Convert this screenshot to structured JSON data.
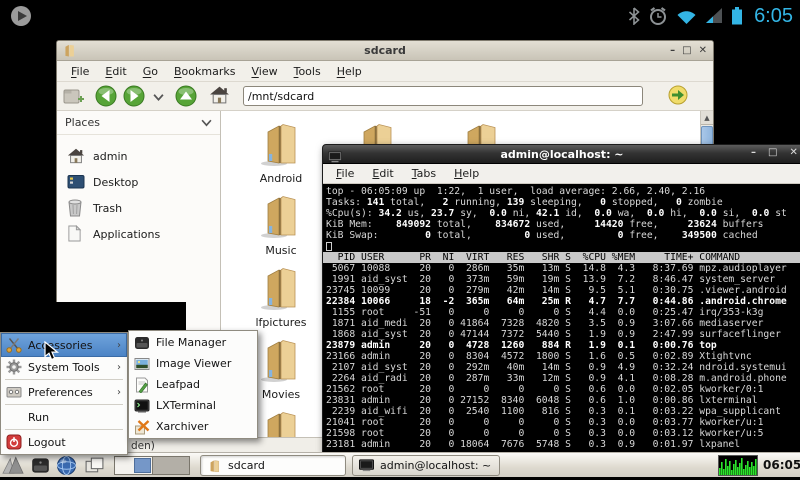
{
  "status_bar": {
    "time": "6:05",
    "accent_color": "#33b5e5",
    "icons": [
      "play-notification-icon",
      "bluetooth-icon",
      "alarm-icon",
      "wifi-icon",
      "signal-icon",
      "battery-icon"
    ]
  },
  "file_manager": {
    "title": "sdcard",
    "menu": [
      "File",
      "Edit",
      "Go",
      "Bookmarks",
      "View",
      "Tools",
      "Help"
    ],
    "toolbar": {
      "path_value": "/mnt/sdcard"
    },
    "sidebar": {
      "header": "Places",
      "items": [
        {
          "label": "admin",
          "icon": "home-icon"
        },
        {
          "label": "Desktop",
          "icon": "desktop-icon"
        },
        {
          "label": "Trash",
          "icon": "trash-icon"
        },
        {
          "label": "Applications",
          "icon": "applications-icon"
        }
      ]
    },
    "folders": [
      "Android",
      "Music",
      "lfpictures",
      "Movies"
    ],
    "status_text": "den)"
  },
  "terminal": {
    "title": "admin@localhost: ~",
    "menu": [
      "File",
      "Edit",
      "Tabs",
      "Help"
    ],
    "summary_lines": [
      [
        [
          "top - 06:05:09 up  1:22,  1 user,  load average: 2.66, 2.40, 2.16",
          0
        ]
      ],
      [
        [
          "Tasks: ",
          0
        ],
        [
          "141",
          1
        ],
        [
          " total,   ",
          0
        ],
        [
          "2",
          1
        ],
        [
          " running, ",
          0
        ],
        [
          "139",
          1
        ],
        [
          " sleeping,   ",
          0
        ],
        [
          "0",
          1
        ],
        [
          " stopped,   ",
          0
        ],
        [
          "0",
          1
        ],
        [
          " zombie",
          0
        ]
      ],
      [
        [
          "%Cpu(s): ",
          0
        ],
        [
          "34.2",
          1
        ],
        [
          " us, ",
          0
        ],
        [
          "23.7",
          1
        ],
        [
          " sy,  ",
          0
        ],
        [
          "0.0",
          1
        ],
        [
          " ni, ",
          0
        ],
        [
          "42.1",
          1
        ],
        [
          " id,  ",
          0
        ],
        [
          "0.0",
          1
        ],
        [
          " wa,  ",
          0
        ],
        [
          "0.0",
          1
        ],
        [
          " hi,  ",
          0
        ],
        [
          "0.0",
          1
        ],
        [
          " si,  ",
          0
        ],
        [
          "0.0",
          1
        ],
        [
          " st",
          0
        ]
      ],
      [
        [
          "KiB Mem:    ",
          0
        ],
        [
          "849092",
          1
        ],
        [
          " total,    ",
          0
        ],
        [
          "834672",
          1
        ],
        [
          " used,     ",
          0
        ],
        [
          "14420",
          1
        ],
        [
          " free,     ",
          0
        ],
        [
          "23624",
          1
        ],
        [
          " buffers",
          0
        ]
      ],
      [
        [
          "KiB Swap:        ",
          0
        ],
        [
          "0",
          1
        ],
        [
          " total,         ",
          0
        ],
        [
          "0",
          1
        ],
        [
          " used,         ",
          0
        ],
        [
          "0",
          1
        ],
        [
          " free,    ",
          0
        ],
        [
          "349500",
          1
        ],
        [
          " cached",
          0
        ]
      ]
    ],
    "table_header": "  PID USER      PR  NI  VIRT   RES   SHR S  %CPU %MEM     TIME+ COMMAND",
    "rows": [
      {
        "text": " 5067 10088     20   0  286m   35m   13m S  14.8  4.3   8:37.69 mpz.audioplayer",
        "bold": false
      },
      {
        "text": " 1991 aid_syst  20   0  373m   59m   19m S  13.9  7.2   8:46.47 system_server",
        "bold": false
      },
      {
        "text": "23745 10099     20   0  279m   42m   14m S   9.5  5.1   0:30.75 .viewer.android",
        "bold": false
      },
      {
        "text": "22384 10066     18  -2  365m   64m   25m R   4.7  7.7   0:44.86 .android.chrome",
        "bold": true
      },
      {
        "text": " 1155 root     -51   0     0     0     0 S   4.4  0.0   0:25.47 irq/353-k3g",
        "bold": false
      },
      {
        "text": " 1871 aid_medi  20   0 41864  7328  4820 S   3.5  0.9   3:07.66 mediaserver",
        "bold": false
      },
      {
        "text": " 1868 aid_syst  20   0 47144  7372  5440 S   1.9  0.9   2:47.99 surfaceflinger",
        "bold": false
      },
      {
        "text": "23879 admin     20   0  4728  1260   884 R   1.9  0.1   0:00.76 top",
        "bold": true
      },
      {
        "text": "23166 admin     20   0  8304  4572  1800 S   1.6  0.5   0:02.89 Xtightvnc",
        "bold": false
      },
      {
        "text": " 2107 aid_syst  20   0  292m   40m   14m S   0.9  4.9   0:32.24 ndroid.systemui",
        "bold": false
      },
      {
        "text": " 2264 aid_radi  20   0  287m   33m   12m S   0.9  4.1   0:08.28 m.android.phone",
        "bold": false
      },
      {
        "text": "21562 root      20   0     0     0     0 S   0.6  0.0   0:02.05 kworker/0:1",
        "bold": false
      },
      {
        "text": "23831 admin     20   0 27152  8340  6048 S   0.6  1.0   0:00.86 lxterminal",
        "bold": false
      },
      {
        "text": " 2239 aid_wifi  20   0  2540  1100   816 S   0.3  0.1   0:03.22 wpa_supplicant",
        "bold": false
      },
      {
        "text": "21041 root      20   0     0     0     0 S   0.3  0.0   0:03.77 kworker/u:1",
        "bold": false
      },
      {
        "text": "21598 root      20   0     0     0     0 S   0.3  0.0   0:03.12 kworker/u:5",
        "bold": false
      },
      {
        "text": "23181 admin     20   0 18064  7676  5748 S   0.3  0.9   0:01.97 lxpanel",
        "bold": false
      }
    ]
  },
  "start_menu": {
    "items": [
      {
        "label": "Accessories",
        "icon": "accessories-icon",
        "submenu": true,
        "highlighted": true
      },
      {
        "label": "System Tools",
        "icon": "system-tools-icon",
        "submenu": true
      },
      {
        "separator": true
      },
      {
        "label": "Preferences",
        "icon": "preferences-icon",
        "submenu": true
      },
      {
        "separator": true
      },
      {
        "label": "Run"
      },
      {
        "separator": true
      },
      {
        "label": "Logout",
        "icon": "logout-icon"
      }
    ],
    "submenu": [
      {
        "label": "File Manager",
        "icon": "file-manager-icon"
      },
      {
        "label": "Image Viewer",
        "icon": "image-viewer-icon"
      },
      {
        "label": "Leafpad",
        "icon": "leafpad-icon"
      },
      {
        "label": "LXTerminal",
        "icon": "lxterminal-icon"
      },
      {
        "label": "Xarchiver",
        "icon": "xarchiver-icon"
      }
    ]
  },
  "taskbar": {
    "launchers": [
      "lxde-menu-icon",
      "file-manager-icon",
      "browser-icon",
      "show-desktop-icon"
    ],
    "pager_desktops": 2,
    "windows": [
      {
        "label": "sdcard",
        "icon": "folder-icon",
        "active": true
      },
      {
        "label": "admin@localhost: ~",
        "icon": "terminal-icon",
        "active": false
      }
    ],
    "clock": "06:05"
  }
}
